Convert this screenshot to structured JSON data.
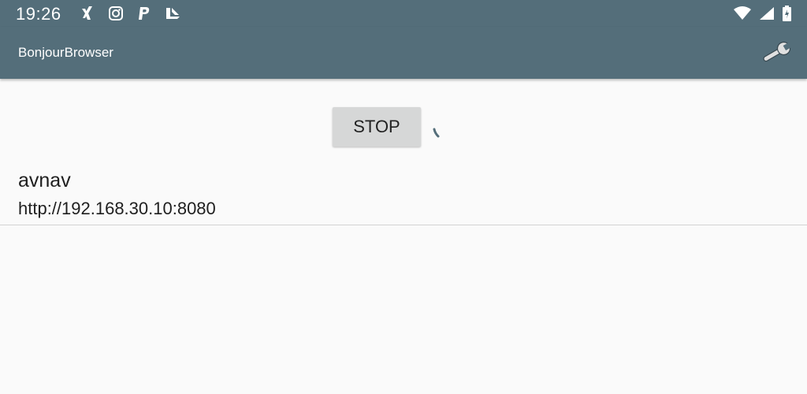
{
  "status_bar": {
    "time": "19:26",
    "notification_icons": [
      "xing-icon",
      "instagram-icon",
      "paypal-icon",
      "feedly-icon"
    ],
    "system_icons": [
      "wifi-icon",
      "cell-signal-icon",
      "battery-charging-icon"
    ]
  },
  "app_bar": {
    "title": "BonjourBrowser",
    "settings_icon": "wrench-icon",
    "background_color": "#546e7a"
  },
  "main": {
    "stop_button_label": "STOP",
    "services": [
      {
        "name": "avnav",
        "url": "http://192.168.30.10:8080"
      }
    ]
  }
}
